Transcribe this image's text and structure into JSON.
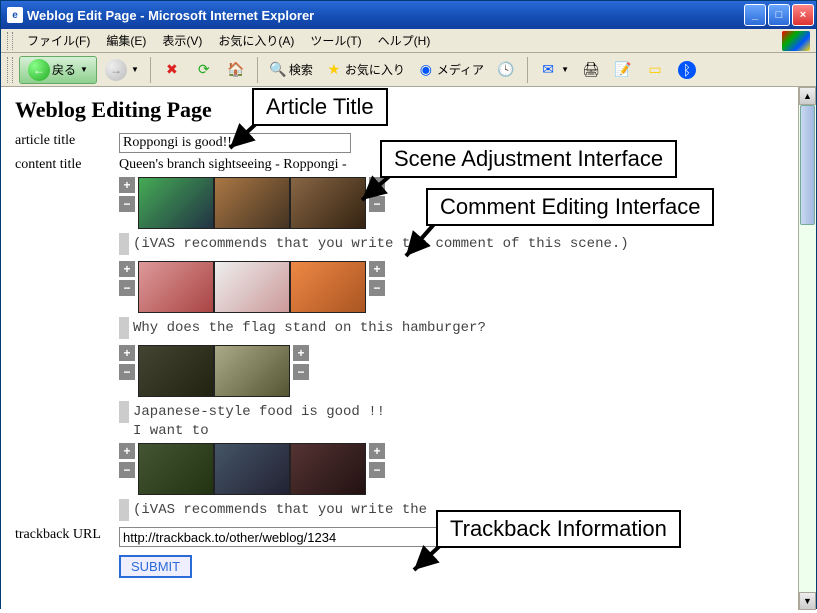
{
  "window": {
    "title": "Weblog Edit Page - Microsoft Internet Explorer"
  },
  "menubar": {
    "items": [
      {
        "label": "ファイル(F)"
      },
      {
        "label": "編集(E)"
      },
      {
        "label": "表示(V)"
      },
      {
        "label": "お気に入り(A)"
      },
      {
        "label": "ツール(T)"
      },
      {
        "label": "ヘルプ(H)"
      }
    ]
  },
  "toolbar": {
    "back": "戻る",
    "search": "検索",
    "favorites": "お気に入り",
    "media": "メディア"
  },
  "page": {
    "heading": "Weblog Editing Page",
    "article_title_label": "article title",
    "article_title_value": "Roppongi is good!!",
    "content_title_label": "content title",
    "content_title_value": "Queen's branch sightseeing - Roppongi -",
    "trackback_label": "trackback URL",
    "trackback_value": "http://trackback.to/other/weblog/1234",
    "submit_label": "SUBMIT"
  },
  "scenes": [
    {
      "thumbs": 3,
      "comment": "(iVAS recommends that you write the comment of this scene.)"
    },
    {
      "thumbs": 3,
      "comment": "Why does the flag stand on this hamburger?"
    },
    {
      "thumbs": 2,
      "comment": "Japanese-style food is good !!",
      "comment2": "I want to "
    },
    {
      "thumbs": 3,
      "comment": "(iVAS recommends that you write the"
    }
  ],
  "callouts": {
    "article_title": "Article Title",
    "scene_adjust": "Scene Adjustment Interface",
    "comment_edit": "Comment Editing Interface",
    "trackback_info": "Trackback Information"
  }
}
